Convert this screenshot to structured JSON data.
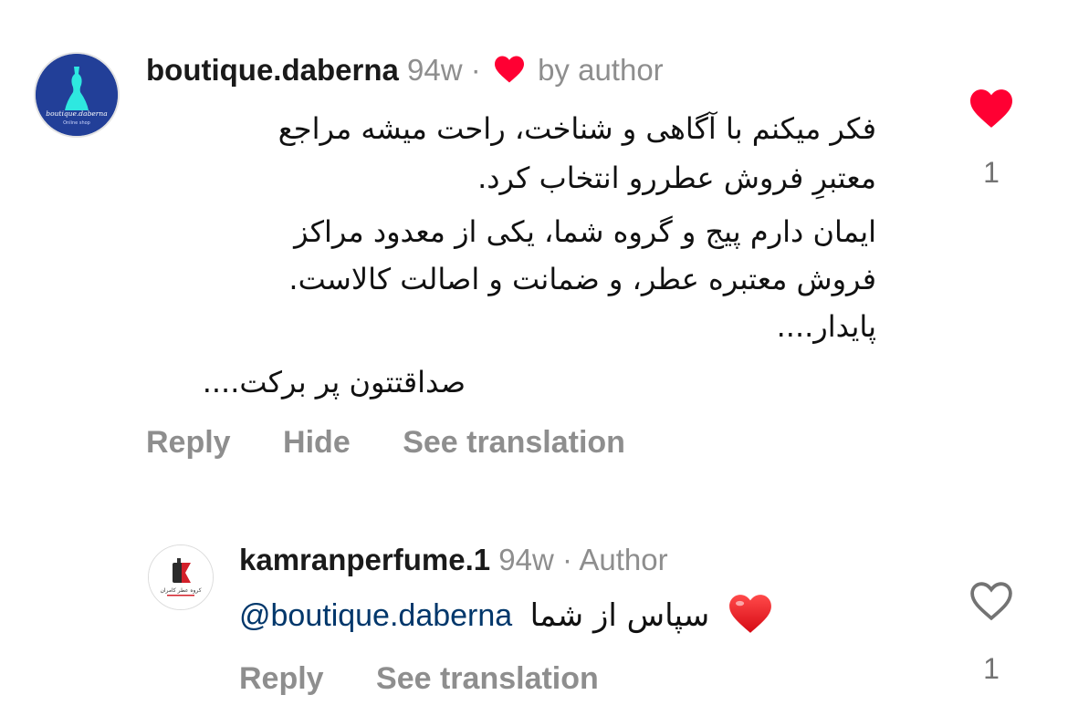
{
  "comments": [
    {
      "username": "boutique.daberna",
      "time": "94w",
      "separator": "·",
      "liked_by_author_label": "by author",
      "avatar_text": "boutique.daberna",
      "avatar_subtext": "Online shop",
      "paragraphs": [
        [
          "فکر میکنم با آگاهی و شناخت، راحت میشه مراجع",
          "معتبرِ فروش عطررو انتخاب کرد."
        ],
        [
          "ایمان دارم پیج و گروه شما، یکی از معدود مراکز",
          "فروش معتبره عطر، و ضمانت و اصالت کالاست.",
          "پایدار...."
        ],
        [
          "صداقتتون پر برکت...."
        ]
      ],
      "actions": [
        "Reply",
        "Hide",
        "See translation"
      ],
      "like_count": "1",
      "liked": true,
      "heart_color": "#ff0033"
    },
    {
      "username": "kamranperfume.1",
      "time": "94w",
      "separator": "·",
      "author_label": "Author",
      "avatar_text": "کروه عطر کامران",
      "mention": "@boutique.daberna",
      "reply_text": "سپاس از شما",
      "emoji": "red-heart",
      "actions": [
        "Reply",
        "See translation"
      ],
      "like_count": "1",
      "liked": false
    }
  ],
  "colors": {
    "muted": "#8e8e8e",
    "mention": "#00376b",
    "like_red": "#ff0033"
  }
}
